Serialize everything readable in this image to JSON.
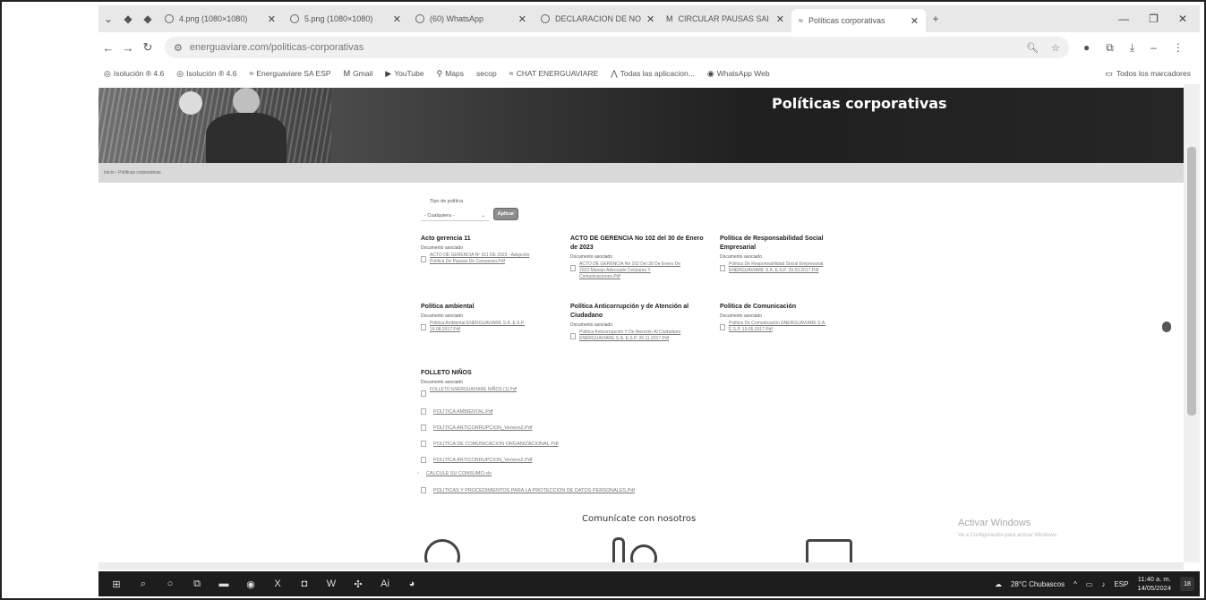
{
  "browser": {
    "tabs": [
      {
        "label": "4.png (1080×1080)",
        "active": false
      },
      {
        "label": "5.png (1080×1080)",
        "active": false
      },
      {
        "label": "(60) WhatsApp",
        "active": false
      },
      {
        "label": "DECLARACION DE NO",
        "active": false
      },
      {
        "label": "CIRCULAR PAUSAS SAI",
        "active": false
      },
      {
        "label": "Políticas corporativas",
        "active": true
      }
    ],
    "address": "energuaviare.com/politicas-corporativas",
    "bookmarks": [
      "Isolución ® 4.6",
      "Isolución ® 4.6",
      "Energuaviare SA ESP",
      "Gmail",
      "YouTube",
      "Maps",
      "secop",
      "CHAT ENERGUAVIARE",
      "Todas las aplicacion...",
      "WhatsApp Web"
    ],
    "all_bookmarks": "Todos los marcadores"
  },
  "page": {
    "hero_title": "Políticas corporativas",
    "breadcrumb": "Inicio › Políticas corporativas",
    "filter": {
      "label": "Tipo de política",
      "selected": "- Cualquiera -",
      "apply": "Aplicar"
    },
    "policies": [
      {
        "title": "Acto gerencia 11",
        "label": "Documento asociado",
        "doc": "ACTO DE GERENCIA Nº 011 DE 2023 - Adopción Política De Pausas De Cansancio.Pdf"
      },
      {
        "title": "ACTO DE GERENCIA No 102 del 30 de Enero de 2023",
        "label": "Documento asociado",
        "doc": "ACTO DE GERENCIA No 102 Del 30 De Enero De 2023 Manejo Adecuado Celulares Y Comunicaciones.Pdf"
      },
      {
        "title": "Política de Responsabilidad Social Empresarial",
        "label": "Documento asociado",
        "doc": "Politica De Responsabilidad Social Empresarial ENERGUAVIARE S.A. E.S.P. 29.03.2017.Pdf"
      },
      {
        "title": "Política ambiental",
        "label": "Documento asociado",
        "doc": "Politica Ambiental ENERGUAVIARE S.A. E.S.P. 16.08.2017.Pdf"
      },
      {
        "title": "Política Anticorrupción y de Atención al Ciudadano",
        "label": "Documento asociado",
        "doc": "Politica Anticorrupción Y De Atención Al Ciudadano ENERGUAVIARE S.A. E.S.P. 26.11.2017.Pdf"
      },
      {
        "title": "Política de Comunicación",
        "label": "Documento asociado",
        "doc": "Politica De Comunicación ENERGUAVIARE S.A. E.S.P. 19.05.2017.Pdf"
      },
      {
        "title": "FOLLETO NIÑOS",
        "label": "Documento asociado",
        "doc": "FOLLETO ENERGUAVIARE NIÑOS (1).Pdf"
      }
    ],
    "files": [
      "POLITICA AMBIENTAL.Pdf",
      "POLITICA ANTICORRUPCION_Version2.Pdf",
      "POLITICA DE COMUNICACION ORGANIZACIONAL.Pdf",
      "POLITICA ANTICORRUPCION_Version2.Pdf",
      "CALCULE SU CONSUMO.xls",
      "POLITICAS Y PROCEDIMIENTOS PARA LA PROTECCION DE DATOS PERSONALES.Pdf"
    ],
    "contact_title": "Comunícate con nosotros",
    "watermark_title": "Activar Windows",
    "watermark_sub": "Ve a Configuración para activar Windows."
  },
  "taskbar": {
    "weather": "28°C Chubascos",
    "lang": "ESP",
    "time": "11:40 a. m.",
    "date": "14/05/2024",
    "notifications": "18"
  }
}
